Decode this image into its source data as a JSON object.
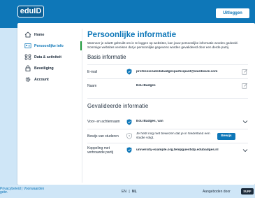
{
  "header": {
    "logo": "eduID",
    "login_label": "Uitloggen"
  },
  "sidebar": {
    "items": [
      {
        "label": "Home",
        "icon": "home-icon"
      },
      {
        "label": "Persoonlijke info",
        "icon": "id-card-icon",
        "active": true
      },
      {
        "label": "Data & activiteit",
        "icon": "data-icon"
      },
      {
        "label": "Beveiliging",
        "icon": "lock-icon"
      },
      {
        "label": "Account",
        "icon": "gear-icon"
      }
    ]
  },
  "main": {
    "title": "Persoonlijke informatie",
    "intro": "Wanneer je eduID gebruikt om in te loggen op websites, kan jouw persoonlijke informatie worden gedeeld. Sommige websites vereisen dat je persoonlijke gegevens worden gevalideerd door een derde partij.",
    "basic_title": "Basis informatie",
    "basic_rows": [
      {
        "label": "E-mail",
        "value": "professionaledubadgesparticipant@wardware.com"
      },
      {
        "label": "Naam",
        "value": "Edu Badges"
      }
    ],
    "validated_title": "Gevalideerde informatie",
    "validated_rows": [
      {
        "label": "Voor- en achternaam",
        "value": "Edu Badges, van"
      },
      {
        "label": "Bewijs van studeren",
        "value": "Je hebt nog niet bewezen dat je in Nederland een studie volgt.",
        "button": "Bewijs"
      },
      {
        "label": "Koppeling met vertrouwde partij",
        "value": "university-example.org.tempguestidp.edubadges.nl"
      }
    ]
  },
  "footer": {
    "links": "Privacybeleid | Voorwaarden",
    "links2": "gebr.",
    "lang_en": "EN",
    "lang_sep": "|",
    "lang_nl": "NL",
    "powered": "Aangeboden door",
    "surf": "SURF"
  },
  "colors": {
    "primary": "#0e77b8",
    "success": "#1e9b3a",
    "background": "#cfe6f7"
  }
}
